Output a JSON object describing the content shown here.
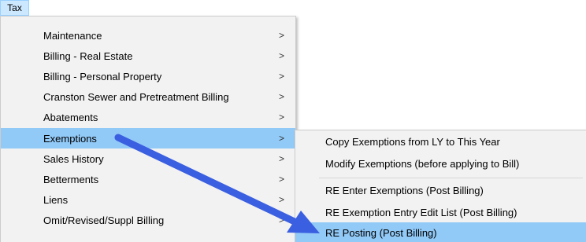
{
  "menubar": {
    "tax_label": "Tax"
  },
  "main_menu": {
    "items": [
      {
        "label": "Maintenance",
        "chevron": ">"
      },
      {
        "label": "Billing - Real Estate",
        "chevron": ">"
      },
      {
        "label": "Billing - Personal Property",
        "chevron": ">"
      },
      {
        "label": "Cranston Sewer and Pretreatment Billing",
        "chevron": ">"
      },
      {
        "label": "Abatements",
        "chevron": ">"
      },
      {
        "label": "Exemptions",
        "chevron": ">"
      },
      {
        "label": "Sales History",
        "chevron": ">"
      },
      {
        "label": "Betterments",
        "chevron": ">"
      },
      {
        "label": "Liens",
        "chevron": ">"
      },
      {
        "label": "Omit/Revised/Suppl Billing",
        "chevron": ">"
      }
    ],
    "highlighted_item": "Exemptions",
    "highlight_color": "#91c9f7"
  },
  "sub_menu": {
    "items": [
      {
        "label": "Copy Exemptions from LY to This Year"
      },
      {
        "label": "Modify Exemptions (before applying to Bill)"
      },
      {
        "label": "RE Enter Exemptions (Post Billing)"
      },
      {
        "label": "RE Exemption Entry Edit List (Post Billing)"
      },
      {
        "label": "RE Posting (Post Billing)"
      }
    ],
    "highlighted_item": "RE Posting (Post Billing)"
  },
  "annotation": {
    "arrow_color": "#3a5fe0",
    "arrow_icon": "arrow-annotation-icon"
  }
}
